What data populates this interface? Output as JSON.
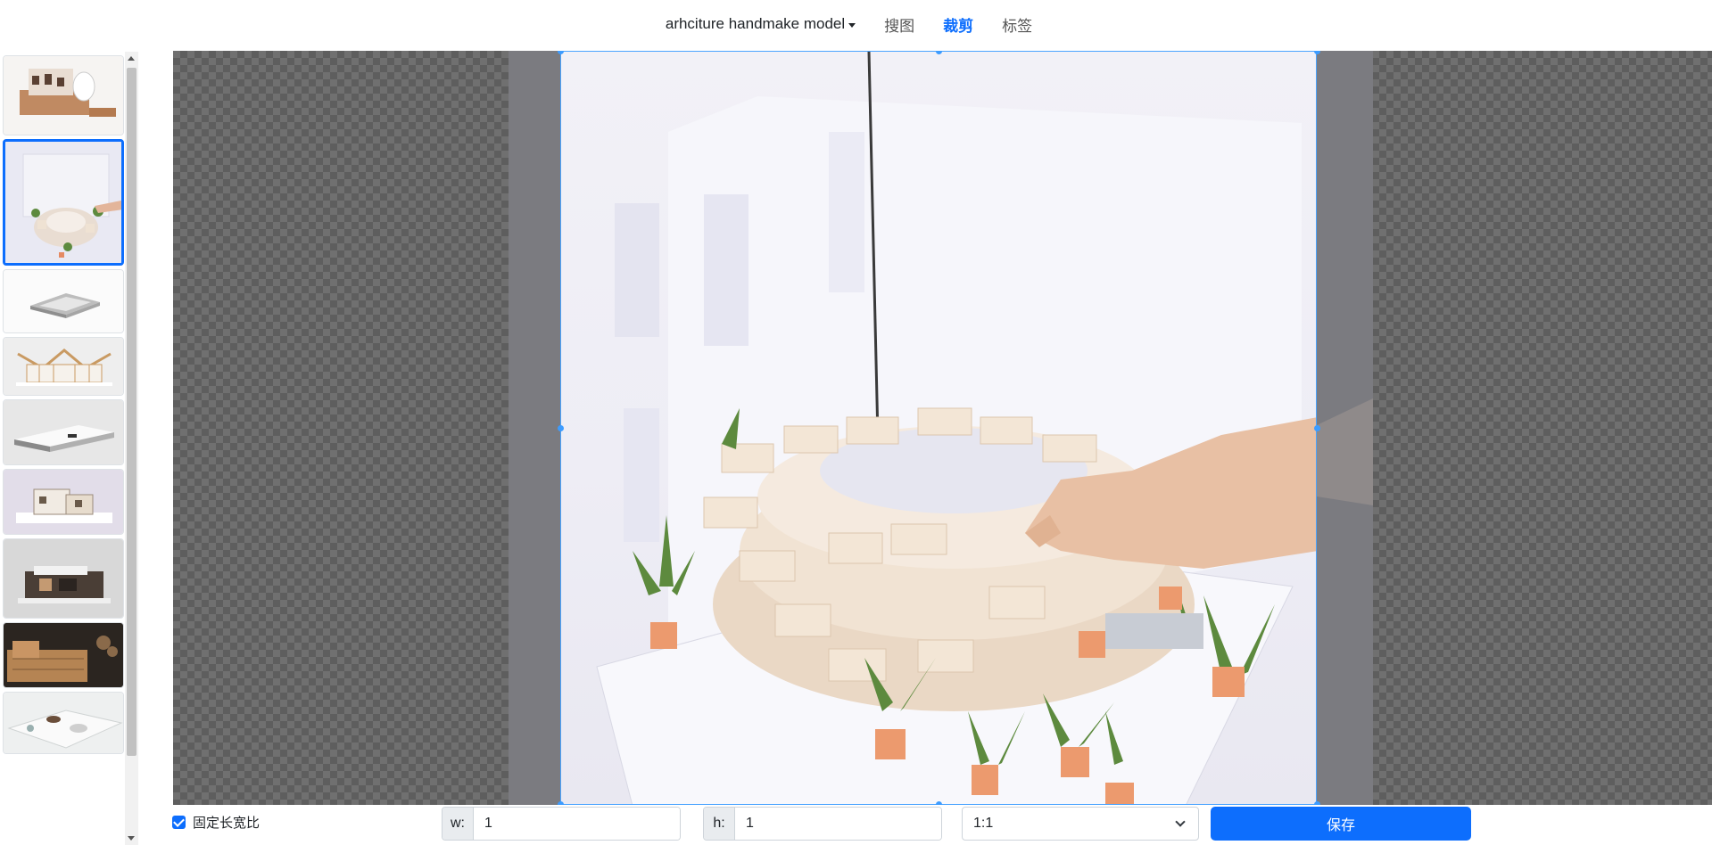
{
  "nav": {
    "dataset_label": "arhciture handmake model",
    "tabs": [
      {
        "label": "搜图",
        "active": false
      },
      {
        "label": "裁剪",
        "active": true
      },
      {
        "label": "标签",
        "active": false
      }
    ]
  },
  "thumbnails": [
    {
      "subject": "building-section-model",
      "selected": false,
      "bg": "#f4f2f0"
    },
    {
      "subject": "brick-ring-model-with-plants",
      "selected": true,
      "bg": "#e8e8f2"
    },
    {
      "subject": "white-stepped-plinth-model",
      "selected": false,
      "bg": "#f0f0f0"
    },
    {
      "subject": "wood-frame-gable-model",
      "selected": false,
      "bg": "#ecebec"
    },
    {
      "subject": "flat-white-slab-model",
      "selected": false,
      "bg": "#e6e6e6"
    },
    {
      "subject": "mixed-material-house-model",
      "selected": false,
      "bg": "#e2dee8"
    },
    {
      "subject": "dark-villa-model",
      "selected": false,
      "bg": "#d4d4d4"
    },
    {
      "subject": "timber-landscape-model",
      "selected": false,
      "bg": "#2a2420"
    },
    {
      "subject": "white-site-model",
      "selected": false,
      "bg": "#eef0f0"
    }
  ],
  "crop": {
    "fixed_ratio_label": "固定长宽比",
    "fixed_ratio_checked": true,
    "width_label": "w:",
    "width_value": "1",
    "height_label": "h:",
    "height_value": "1",
    "ratio_select_value": "1:1",
    "save_label": "保存"
  },
  "colors": {
    "accent": "#0d6efd",
    "crop_border": "#4aa3ff"
  }
}
